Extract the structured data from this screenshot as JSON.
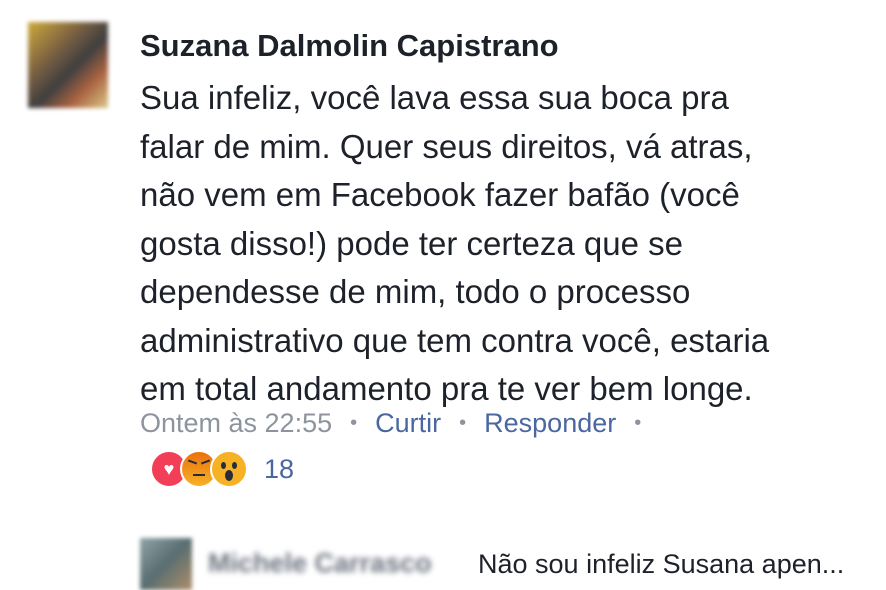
{
  "comment": {
    "author": "Suzana Dalmolin Capistrano",
    "lines": [
      "Sua infeliz, você lava essa sua boca pra",
      "falar de mim. Quer seus direitos, vá atras,",
      "não vem em Facebook fazer bafão (você",
      "gosta disso!) pode ter certeza que se",
      "dependesse de mim, todo o processo",
      "administrativo que tem contra você, estaria",
      "em total andamento pra te ver bem longe."
    ],
    "timestamp": "Ontem às 22:55",
    "like_label": "Curtir",
    "reply_label": "Responder",
    "reactions": {
      "icons": [
        "love-icon",
        "angry-icon",
        "wow-icon"
      ],
      "count": "18"
    }
  },
  "reply": {
    "author": "Michele Carrasco",
    "preview": "Não sou infeliz Susana apen..."
  },
  "colors": {
    "text": "#1d2129",
    "meta": "#8d949e",
    "link": "#4b67a1",
    "love": "#f33e58",
    "angry": "#e9710f",
    "wow": "#f7b125"
  }
}
